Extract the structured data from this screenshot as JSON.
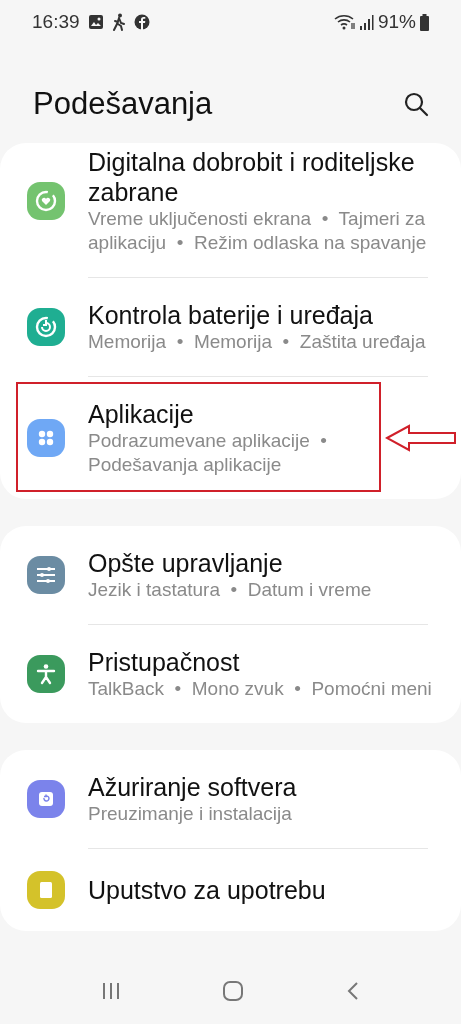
{
  "status_bar": {
    "time": "16:39",
    "battery": "91%"
  },
  "header": {
    "title": "Podešavanja"
  },
  "groups": [
    {
      "items": [
        {
          "kind": "heart",
          "color": "#74c36f",
          "title": "Digitalna dobrobit i roditeljske zabrane",
          "subtitle": "Vreme uključenosti ekrana  •  Tajmeri za aplikaciju  •  Režim odlaska na spavanje",
          "highlighted": false
        },
        {
          "kind": "refresh",
          "color": "#1fae92",
          "title": "Kontrola baterije i uređaja",
          "subtitle": "Memorija  •  Memorija  •  Zaštita uređaja",
          "highlighted": false
        },
        {
          "kind": "apps",
          "color": "#6fa8f5",
          "title": "Aplikacije",
          "subtitle": "Podrazumevane aplikacije  •  Podešavanja aplikacije",
          "highlighted": true
        }
      ]
    },
    {
      "items": [
        {
          "kind": "sliders",
          "color": "#6b8ca3",
          "title": "Opšte upravljanje",
          "subtitle": "Jezik i tastatura  •  Datum i vreme",
          "highlighted": false
        },
        {
          "kind": "person",
          "color": "#3b9a5d",
          "title": "Pristupačnost",
          "subtitle": "TalkBack  •  Mono zvuk  •  Pomoćni meni",
          "highlighted": false
        }
      ]
    },
    {
      "items": [
        {
          "kind": "update",
          "color": "#7b83eb",
          "title": "Ažuriranje softvera",
          "subtitle": "Preuzimanje i instalacija",
          "highlighted": false
        },
        {
          "kind": "book",
          "color": "#d4c22a",
          "title": "Uputstvo za upotrebu",
          "highlighted": false
        }
      ]
    }
  ]
}
